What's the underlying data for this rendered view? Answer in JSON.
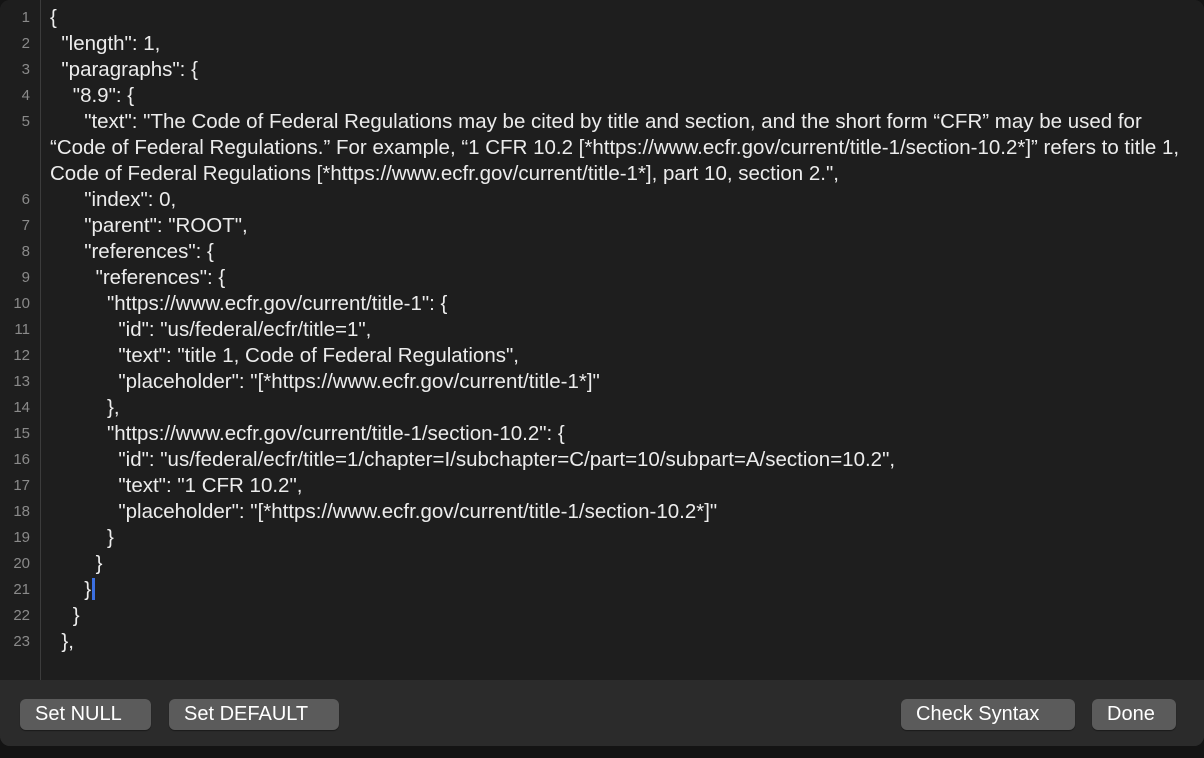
{
  "editor": {
    "lines": [
      {
        "num": "1",
        "text": "{"
      },
      {
        "num": "2",
        "text": "  \"length\": 1,"
      },
      {
        "num": "3",
        "text": "  \"paragraphs\": {"
      },
      {
        "num": "4",
        "text": "    \"8.9\": {"
      },
      {
        "num": "5",
        "text": "      \"text\": \"The Code of Federal Regulations may be cited by title and section, and the short form “CFR” may be used for “Code of Federal Regulations.” For example, “1 CFR 10.2 [*https://www.ecfr.gov/current/title-1/section-10.2*]” refers to title 1, Code of Federal Regulations [*https://www.ecfr.gov/current/title-1*], part 10, section 2.\","
      },
      {
        "num": "6",
        "text": "      \"index\": 0,"
      },
      {
        "num": "7",
        "text": "      \"parent\": \"ROOT\","
      },
      {
        "num": "8",
        "text": "      \"references\": {"
      },
      {
        "num": "9",
        "text": "        \"references\": {"
      },
      {
        "num": "10",
        "text": "          \"https://www.ecfr.gov/current/title-1\": {"
      },
      {
        "num": "11",
        "text": "            \"id\": \"us/federal/ecfr/title=1\","
      },
      {
        "num": "12",
        "text": "            \"text\": \"title 1, Code of Federal Regulations\","
      },
      {
        "num": "13",
        "text": "            \"placeholder\": \"[*https://www.ecfr.gov/current/title-1*]\""
      },
      {
        "num": "14",
        "text": "          },"
      },
      {
        "num": "15",
        "text": "          \"https://www.ecfr.gov/current/title-1/section-10.2\": {"
      },
      {
        "num": "16",
        "text": "            \"id\": \"us/federal/ecfr/title=1/chapter=I/subchapter=C/part=10/subpart=A/section=10.2\","
      },
      {
        "num": "17",
        "text": "            \"text\": \"1 CFR 10.2\","
      },
      {
        "num": "18",
        "text": "            \"placeholder\": \"[*https://www.ecfr.gov/current/title-1/section-10.2*]\""
      },
      {
        "num": "19",
        "text": "          }"
      },
      {
        "num": "20",
        "text": "        }"
      },
      {
        "num": "21",
        "text": "      }"
      },
      {
        "num": "22",
        "text": "    }"
      },
      {
        "num": "23",
        "text": "  },"
      }
    ],
    "caret_line": 21
  },
  "footer": {
    "set_null_label": "Set NULL",
    "set_default_label": "Set DEFAULT",
    "check_syntax_label": "Check Syntax",
    "done_label": "Done"
  }
}
